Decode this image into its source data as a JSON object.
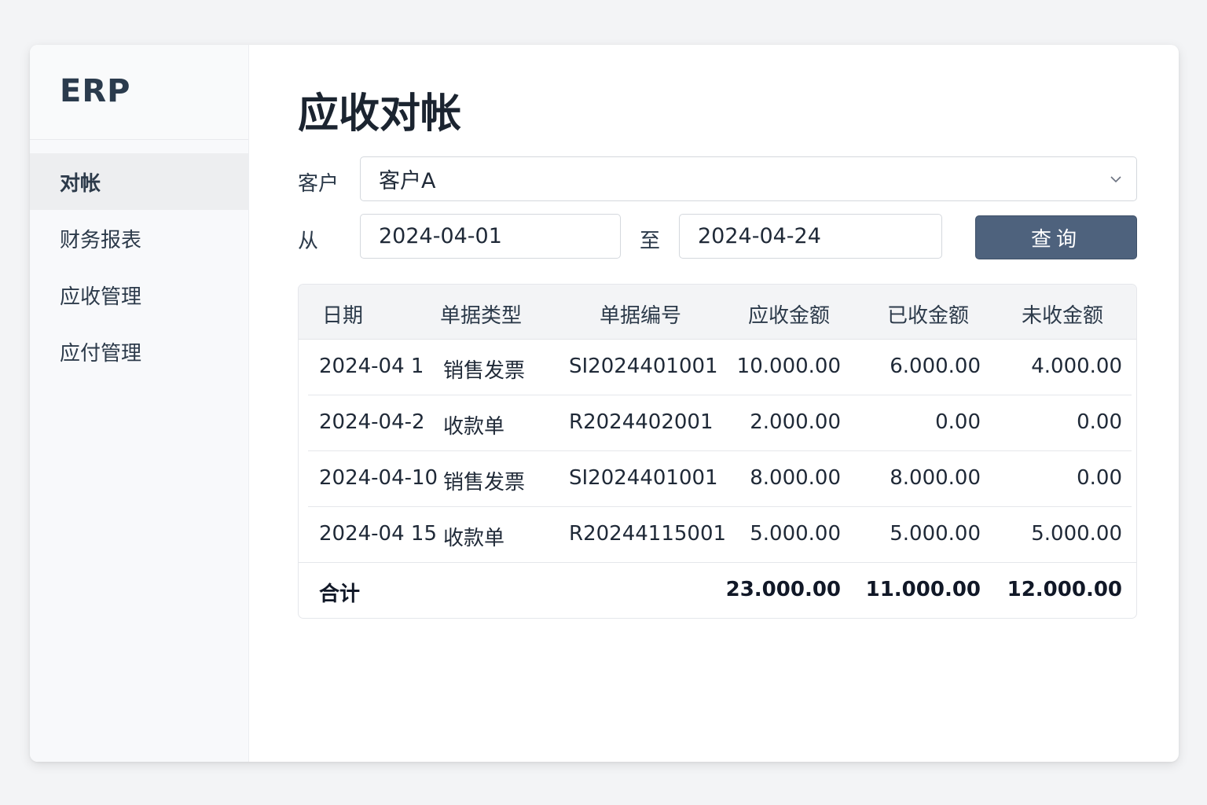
{
  "app": {
    "brand": "ERP"
  },
  "sidebar": {
    "items": [
      {
        "label": "对帐",
        "active": true
      },
      {
        "label": "财务报表"
      },
      {
        "label": "应收管理"
      },
      {
        "label": "应付管理"
      }
    ]
  },
  "page": {
    "title": "应收对帐"
  },
  "filters": {
    "customer_label": "客户",
    "customer_value": "客户A",
    "from_label": "从",
    "from_value": "2024-04-01",
    "to_label": "至",
    "to_value": "2024-04-24",
    "query_button": "查询"
  },
  "table": {
    "headers": [
      "日期",
      "单据类型",
      "单据编号",
      "应收金额",
      "已收金额",
      "未收金额"
    ],
    "rows": [
      [
        "2024-04 1",
        "销售发票",
        "SI2024401001",
        "10.000.00",
        "6.000.00",
        "4.000.00"
      ],
      [
        "2024-04-2",
        "收款单",
        "R2024402001",
        "2.000.00",
        "0.00",
        "0.00"
      ],
      [
        "2024-04-10",
        "销售发票",
        "SI2024401001",
        "8.000.00",
        "8.000.00",
        "0.00"
      ],
      [
        "2024-04 15",
        "收款单",
        "R20244115001",
        "5.000.00",
        "5.000.00",
        "5.000.00"
      ]
    ],
    "total": {
      "label": "合计",
      "receivable": "23.000.00",
      "received": "11.000.00",
      "outstanding": "12.000.00"
    }
  },
  "colors": {
    "accent": "#4e627d",
    "sidebar_bg": "#f8f9fb",
    "active_item_bg": "#edeef0"
  },
  "icons": {
    "dropdown": "chevron-down-icon"
  }
}
